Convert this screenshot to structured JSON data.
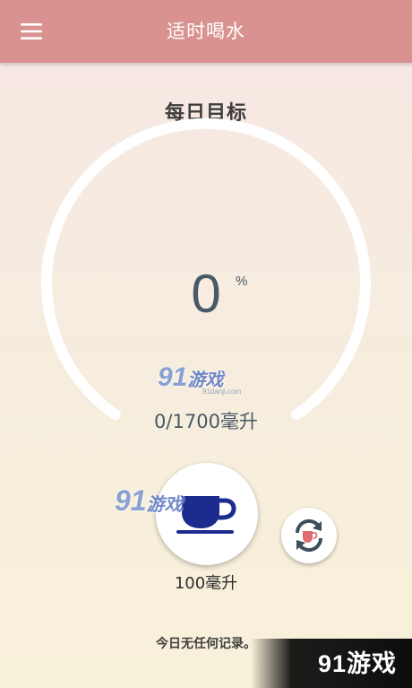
{
  "header": {
    "title": "适时喝水",
    "menu_icon": "menu-icon",
    "background_color": "#d9928f"
  },
  "goal": {
    "title": "每日目标",
    "percent": "0",
    "percent_unit": "%",
    "progress_fraction": 0,
    "progress_text": "0/1700毫升"
  },
  "cup": {
    "icon": "coffee-cup-icon",
    "icon_color": "#1c2b8e",
    "label": "100毫升"
  },
  "switch_cup": {
    "icon": "swap-cup-icon"
  },
  "records": {
    "empty_text": "今日无任何记录。"
  },
  "watermarks": {
    "brand_number": "91",
    "brand_text": "游戏",
    "url": "91danji.com"
  }
}
